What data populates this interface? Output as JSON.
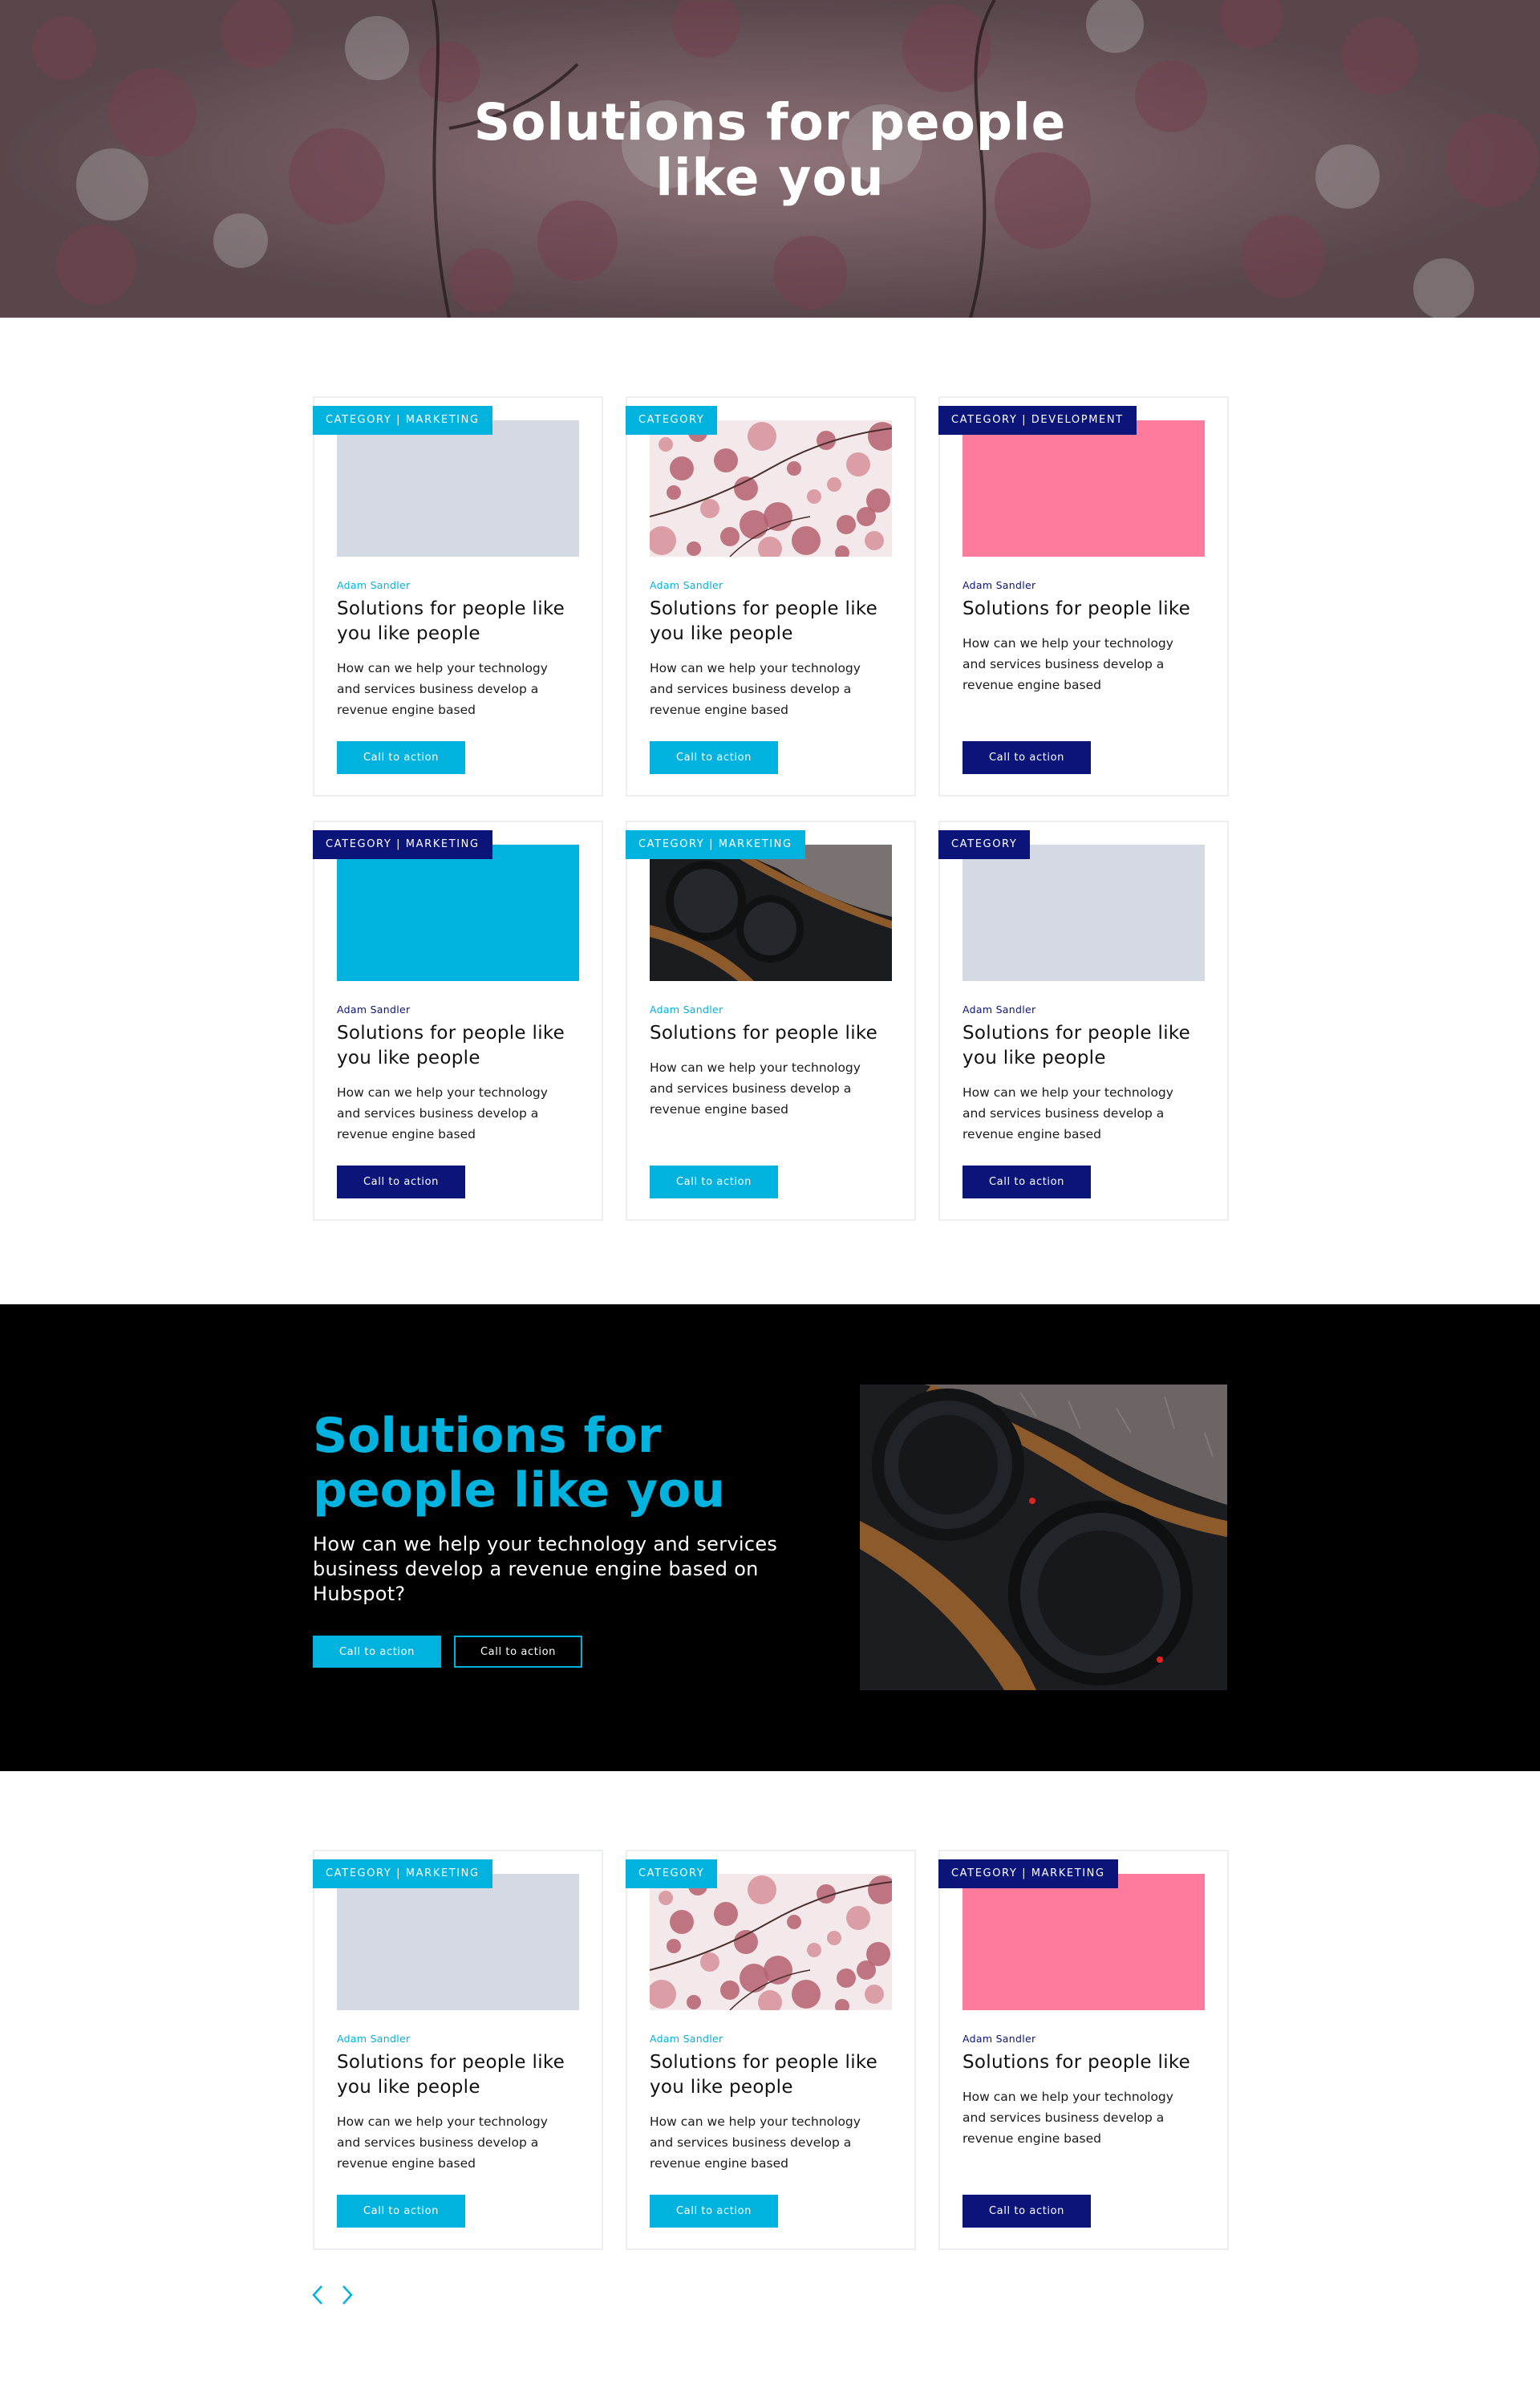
{
  "hero": {
    "title_line1": "Solutions for people",
    "title_line2": "like you"
  },
  "colors": {
    "cyan": "#00b2de",
    "navy": "#0b1478",
    "gray_placeholder": "#d5d9e3",
    "pink_placeholder": "#ff7b9c",
    "black": "#000000"
  },
  "cards_top": [
    {
      "category": "CATEGORY | MARKETING",
      "category_color": "cyan",
      "media": "gray-placeholder",
      "author": "Adam Sandler",
      "author_color": "cyan",
      "title_line1": "Solutions for people like",
      "title_line2": "you like people",
      "desc_lines": [
        "How can we help your technology",
        "and services business develop a",
        "revenue engine based"
      ],
      "button": "Call to action",
      "button_color": "cyan"
    },
    {
      "category": "CATEGORY",
      "category_color": "cyan",
      "media": "cherry-blossom-photo",
      "author": "Adam Sandler",
      "author_color": "cyan",
      "title_line1": "Solutions for people like",
      "title_line2": "you like people",
      "desc_lines": [
        "How can we help your technology",
        "and services business develop a",
        "revenue engine based"
      ],
      "button": "Call to action",
      "button_color": "cyan"
    },
    {
      "category": "CATEGORY | DEVELOPMENT",
      "category_color": "navy",
      "media": "pink-placeholder",
      "author": "Adam Sandler",
      "author_color": "navy",
      "title_line1": "Solutions for people like",
      "title_line2": "",
      "desc_lines": [
        "How can we help your technology",
        "and services business develop a",
        "revenue engine based"
      ],
      "button": "Call to action",
      "button_color": "navy"
    },
    {
      "category": "CATEGORY | MARKETING",
      "category_color": "navy",
      "media": "cyan-placeholder",
      "author": "Adam Sandler",
      "author_color": "navy",
      "title_line1": "Solutions for people like",
      "title_line2": "you like people",
      "desc_lines": [
        "How can we help your technology",
        "and services business develop a",
        "revenue engine based"
      ],
      "button": "Call to action",
      "button_color": "navy"
    },
    {
      "category": "CATEGORY | MARKETING",
      "category_color": "cyan",
      "media": "camera-lens-photo",
      "author": "Adam Sandler",
      "author_color": "cyan",
      "title_line1": "Solutions for people like",
      "title_line2": "",
      "desc_lines": [
        "How can we help your technology",
        "and services business develop a",
        "revenue engine based"
      ],
      "button": "Call to action",
      "button_color": "cyan"
    },
    {
      "category": "CATEGORY",
      "category_color": "navy",
      "media": "gray-placeholder",
      "author": "Adam Sandler",
      "author_color": "navy",
      "title_line1": "Solutions for people like",
      "title_line2": "you like people",
      "desc_lines": [
        "How can we help your technology",
        "and services business develop a",
        "revenue engine based"
      ],
      "button": "Call to action",
      "button_color": "navy"
    }
  ],
  "feature": {
    "title_line1": "Solutions for",
    "title_line2": "people like you",
    "description": "How can we help your technology and services business develop a revenue engine based on Hubspot?",
    "primary_button": "Call to action",
    "secondary_button": "Call to action",
    "image": "camera-lens-photo"
  },
  "cards_bottom": [
    {
      "category": "CATEGORY | MARKETING",
      "category_color": "cyan",
      "media": "gray-placeholder",
      "author": "Adam Sandler",
      "author_color": "cyan",
      "title_line1": "Solutions for people like",
      "title_line2": "you like people",
      "desc_lines": [
        "How can we help your technology",
        "and services business develop a",
        "revenue engine based"
      ],
      "button": "Call to action",
      "button_color": "cyan"
    },
    {
      "category": "CATEGORY",
      "category_color": "cyan",
      "media": "cherry-blossom-photo",
      "author": "Adam Sandler",
      "author_color": "cyan",
      "title_line1": "Solutions for people like",
      "title_line2": "you like people",
      "desc_lines": [
        "How can we help your technology",
        "and services business develop a",
        "revenue engine based"
      ],
      "button": "Call to action",
      "button_color": "cyan"
    },
    {
      "category": "CATEGORY | MARKETING",
      "category_color": "navy",
      "media": "pink-placeholder",
      "author": "Adam Sandler",
      "author_color": "navy",
      "title_line1": "Solutions for people like",
      "title_line2": "",
      "desc_lines": [
        "How can we help your technology",
        "and services business develop a",
        "revenue engine based"
      ],
      "button": "Call to action",
      "button_color": "navy"
    }
  ],
  "carousel": {
    "prev_icon": "chevron-left-icon",
    "next_icon": "chevron-right-icon"
  }
}
